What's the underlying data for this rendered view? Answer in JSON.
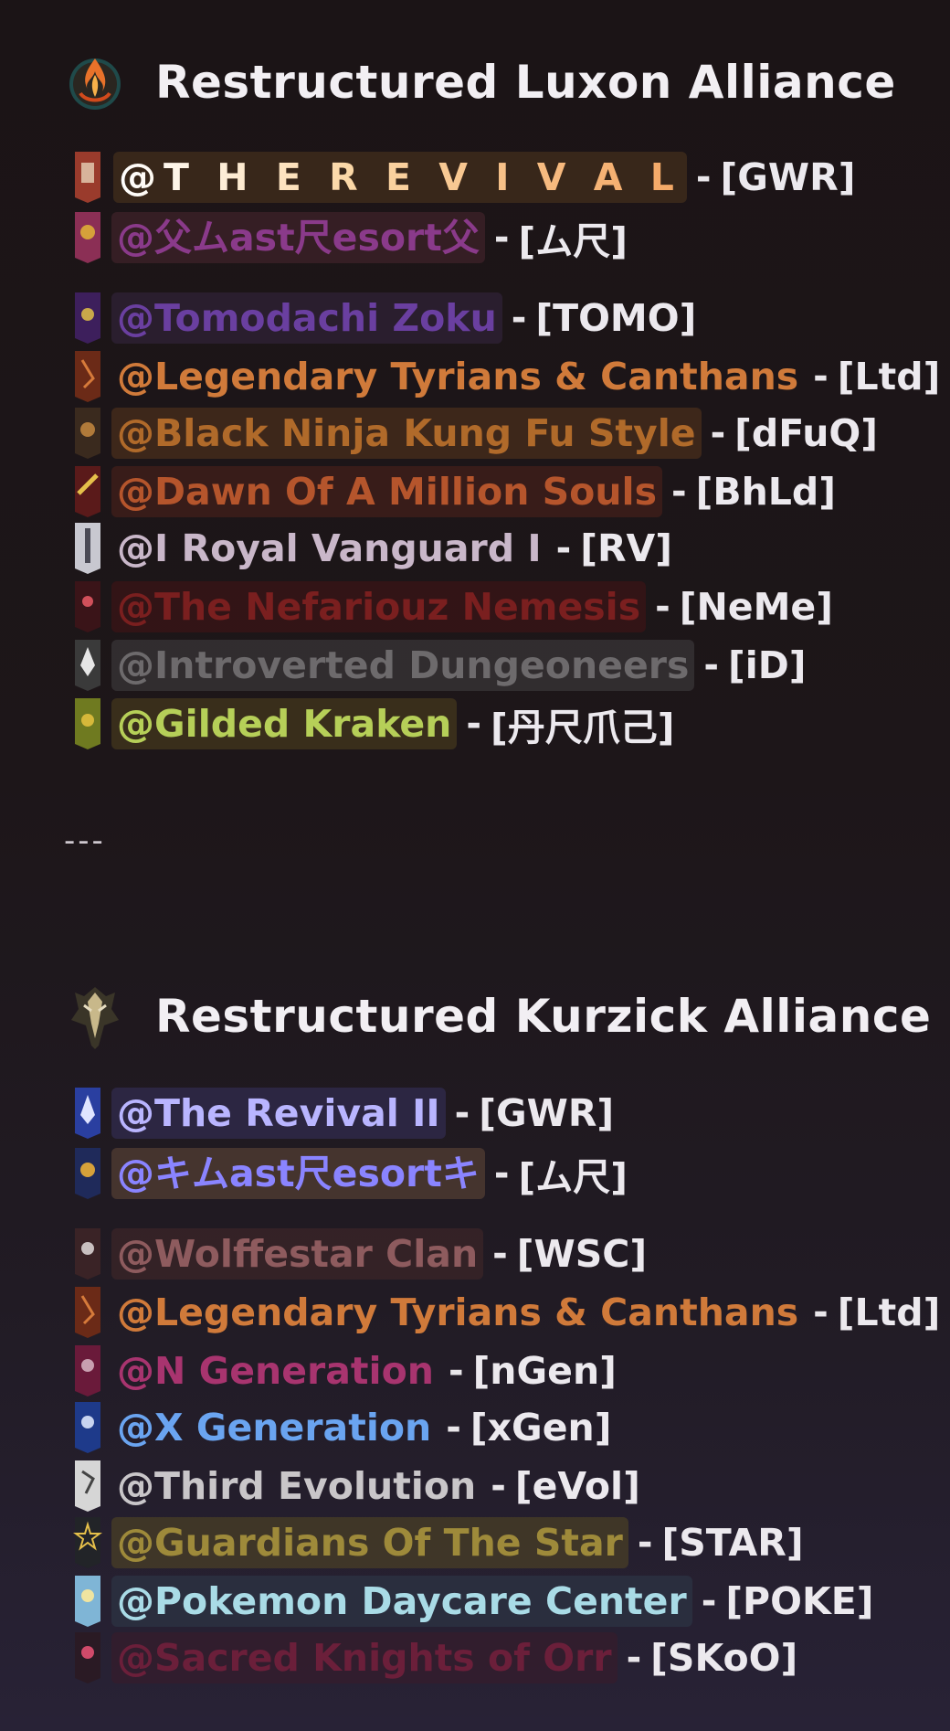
{
  "luxon": {
    "title": "Restructured Luxon Alliance",
    "emblem_icon": "luxon-flame-emblem-icon",
    "guilds": [
      {
        "mention": "@T H E  R E V I V A L",
        "tag": "[GWR]",
        "banner_color": "#9a3b2c"
      },
      {
        "mention": "@父ムast尺esort父",
        "tag": "[ム尺]",
        "banner_color": "#8b2f55"
      },
      {
        "mention": "@Tomodachi Zoku",
        "tag": "[TOMO]",
        "banner_color": "#3d1f5c"
      },
      {
        "mention": "@Legendary Tyrians  & Canthans",
        "tag": "[Ltd]",
        "banner_color": "#6b2a17"
      },
      {
        "mention": "@Black Ninja Kung Fu Style",
        "tag": "[dFuQ]",
        "banner_color": "#3a2a1e"
      },
      {
        "mention": "@Dawn Of A Million Souls",
        "tag": "[BhLd]",
        "banner_color": "#5a1a1a"
      },
      {
        "mention": "@I Royal Vanguard I",
        "tag": "[RV]",
        "banner_color": "#c8c8d0"
      },
      {
        "mention": "@The Nefariouz Nemesis",
        "tag": "[NeMe]",
        "banner_color": "#3a1418"
      },
      {
        "mention": "@Introverted Dungeoneers",
        "tag": "[iD]",
        "banner_color": "#3a3a3a"
      },
      {
        "mention": "@Gilded Kraken",
        "tag": "[丹尺爪己]",
        "banner_color": "#6f7a20"
      }
    ]
  },
  "divider": "---",
  "kurzick": {
    "title": "Restructured Kurzick Alliance",
    "emblem_icon": "kurzick-wolf-emblem-icon",
    "guilds": [
      {
        "mention": "@The Revival II",
        "tag": "[GWR]",
        "banner_color": "#2a3fa0"
      },
      {
        "mention": "@キムast尺esortキ",
        "tag": "[ム尺]",
        "banner_color": "#1f2a5a"
      },
      {
        "mention": "@Wolffestar Clan",
        "tag": "[WSC]",
        "banner_color": "#3a2326"
      },
      {
        "mention": "@Legendary Tyrians  & Canthans",
        "tag": "[Ltd]",
        "banner_color": "#6b2a17"
      },
      {
        "mention": "@N Generation",
        "tag": "[nGen]",
        "banner_color": "#6a1a3a"
      },
      {
        "mention": "@X Generation",
        "tag": "[xGen]",
        "banner_color": "#1e3a8a"
      },
      {
        "mention": "@Third Evolution",
        "tag": "[eVol]",
        "banner_color": "#d6d6d6"
      },
      {
        "mention": "@Guardians Of The Star",
        "tag": "[STAR]",
        "banner_color": "#222428"
      },
      {
        "mention": "@Pokemon Daycare Center",
        "tag": "[POKE]",
        "banner_color": "#7fb5d6"
      },
      {
        "mention": "@Sacred Knights of Orr",
        "tag": "[SKoO]",
        "banner_color": "#2a1a24"
      }
    ]
  }
}
